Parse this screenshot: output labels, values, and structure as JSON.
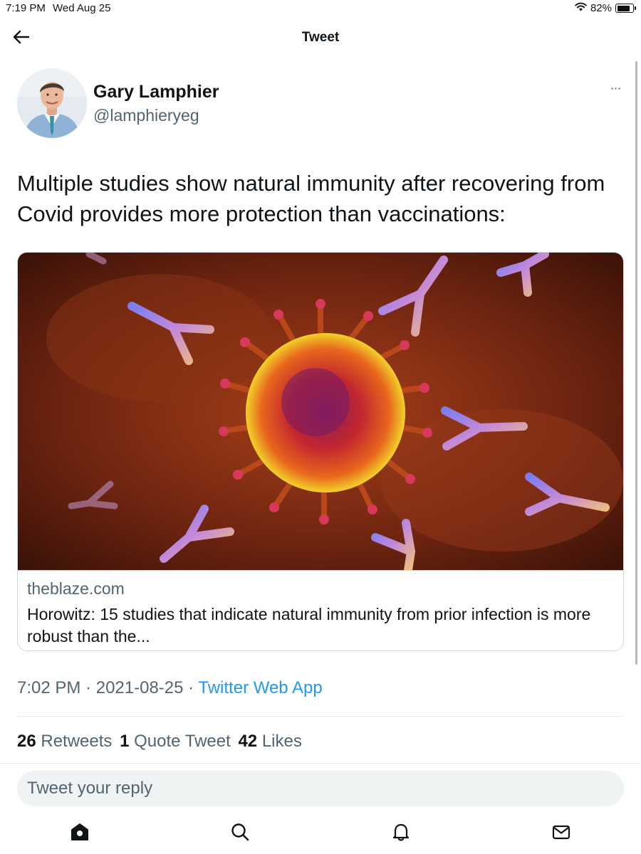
{
  "status_bar": {
    "time": "7:19 PM",
    "date": "Wed Aug 25",
    "battery": "82%",
    "battery_level": 0.82,
    "icons": [
      "wifi-icon",
      "battery-icon"
    ]
  },
  "nav": {
    "title": "Tweet",
    "back_icon": "back-arrow-icon"
  },
  "author": {
    "name": "Gary Lamphier",
    "handle": "@lamphieryeg",
    "more_icon": "more-options-icon"
  },
  "tweet": {
    "text": "Multiple studies show natural immunity after recovering from Covid provides more protection than vaccinations:"
  },
  "card": {
    "image_subject": "coronavirus particle surrounded by antibodies",
    "domain": "theblaze.com",
    "title": "Horowitz: 15 studies that indicate natural immunity from prior infection is more robust than the..."
  },
  "meta": {
    "time": "7:02 PM",
    "separator": " · ",
    "date": "2021-08-25",
    "source": "Twitter Web App"
  },
  "stats": {
    "retweets_count": "26",
    "retweets_label": "Retweets",
    "quotes_count": "1",
    "quotes_label": "Quote Tweet",
    "likes_count": "42",
    "likes_label": "Likes"
  },
  "reply": {
    "placeholder": "Tweet your reply"
  },
  "tabs": [
    {
      "icon": "home-icon",
      "active": true
    },
    {
      "icon": "search-icon",
      "active": false
    },
    {
      "icon": "notifications-icon",
      "active": false
    },
    {
      "icon": "messages-icon",
      "active": false
    }
  ],
  "colors": {
    "accent": "#1d9bf0",
    "text_primary": "#0f1419",
    "text_secondary": "#536471",
    "border": "#cfd9de"
  }
}
